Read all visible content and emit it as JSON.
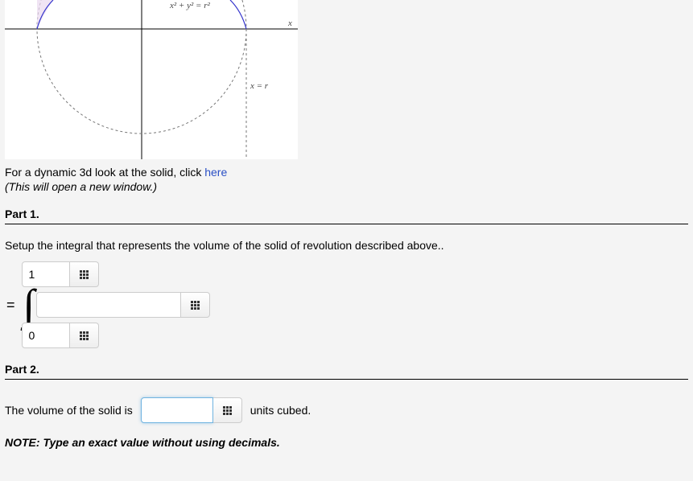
{
  "graph": {
    "equation_top": "x² + y² = r²",
    "axis_label_x": "x",
    "line_label": "x = r"
  },
  "intro": {
    "prefix": "For a dynamic 3d look at the solid, click ",
    "link_text": "here",
    "new_window_note": "(This will open a new window.)"
  },
  "part1": {
    "heading": "Part 1.",
    "setup_text": "Setup the integral that represents the volume of the solid of revolution described above..",
    "upper_bound_value": "1",
    "lower_bound_value": "0",
    "integrand_value": ""
  },
  "part2": {
    "heading": "Part 2.",
    "volume_prefix": "The volume of the solid is",
    "volume_value": "",
    "units_text": "units cubed.",
    "note": "NOTE: Type an exact value without using decimals."
  }
}
